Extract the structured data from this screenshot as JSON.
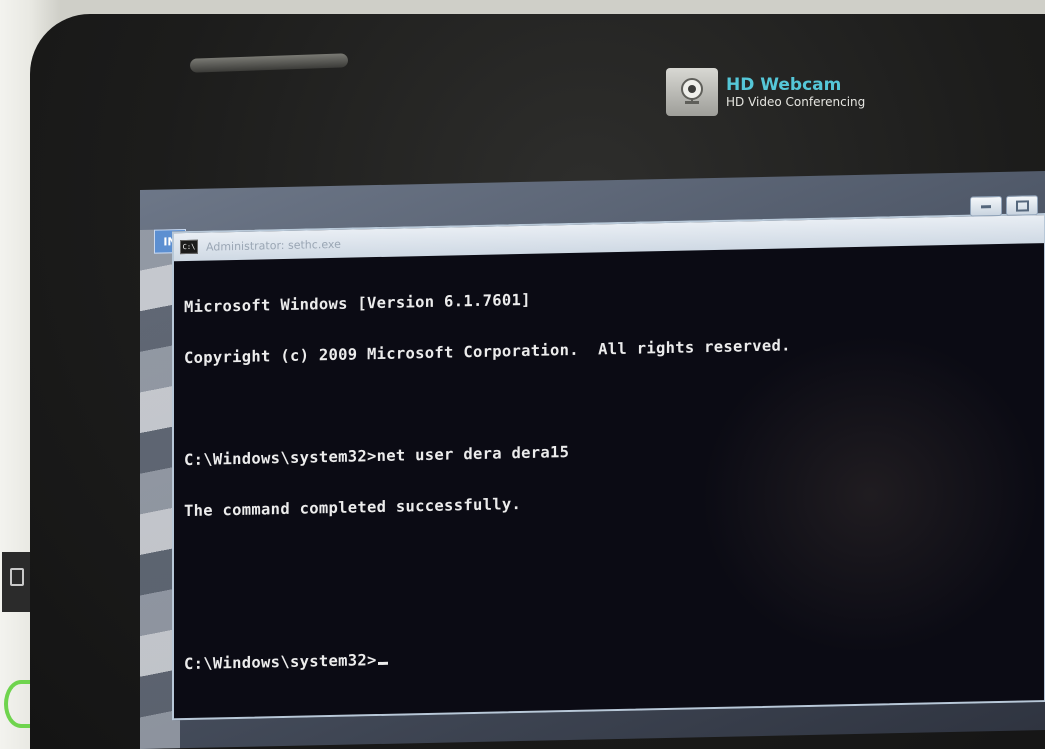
{
  "webcam": {
    "title": "HD Webcam",
    "subtitle": "HD Video Conferencing"
  },
  "taskbar": {
    "language_badge": "IN"
  },
  "window": {
    "icon_text": "C:\\",
    "title": "Administrator: sethc.exe"
  },
  "console": {
    "lines": [
      "Microsoft Windows [Version 6.1.7601]",
      "Copyright (c) 2009 Microsoft Corporation.  All rights reserved.",
      "",
      "C:\\Windows\\system32>net user dera dera15",
      "The command completed successfully.",
      "",
      "",
      "C:\\Windows\\system32>"
    ]
  },
  "colors": {
    "console_bg": "#0b0b14",
    "console_text": "#ececec",
    "webcam_accent": "#55c7d8",
    "bezel": "#1c1c1b"
  }
}
